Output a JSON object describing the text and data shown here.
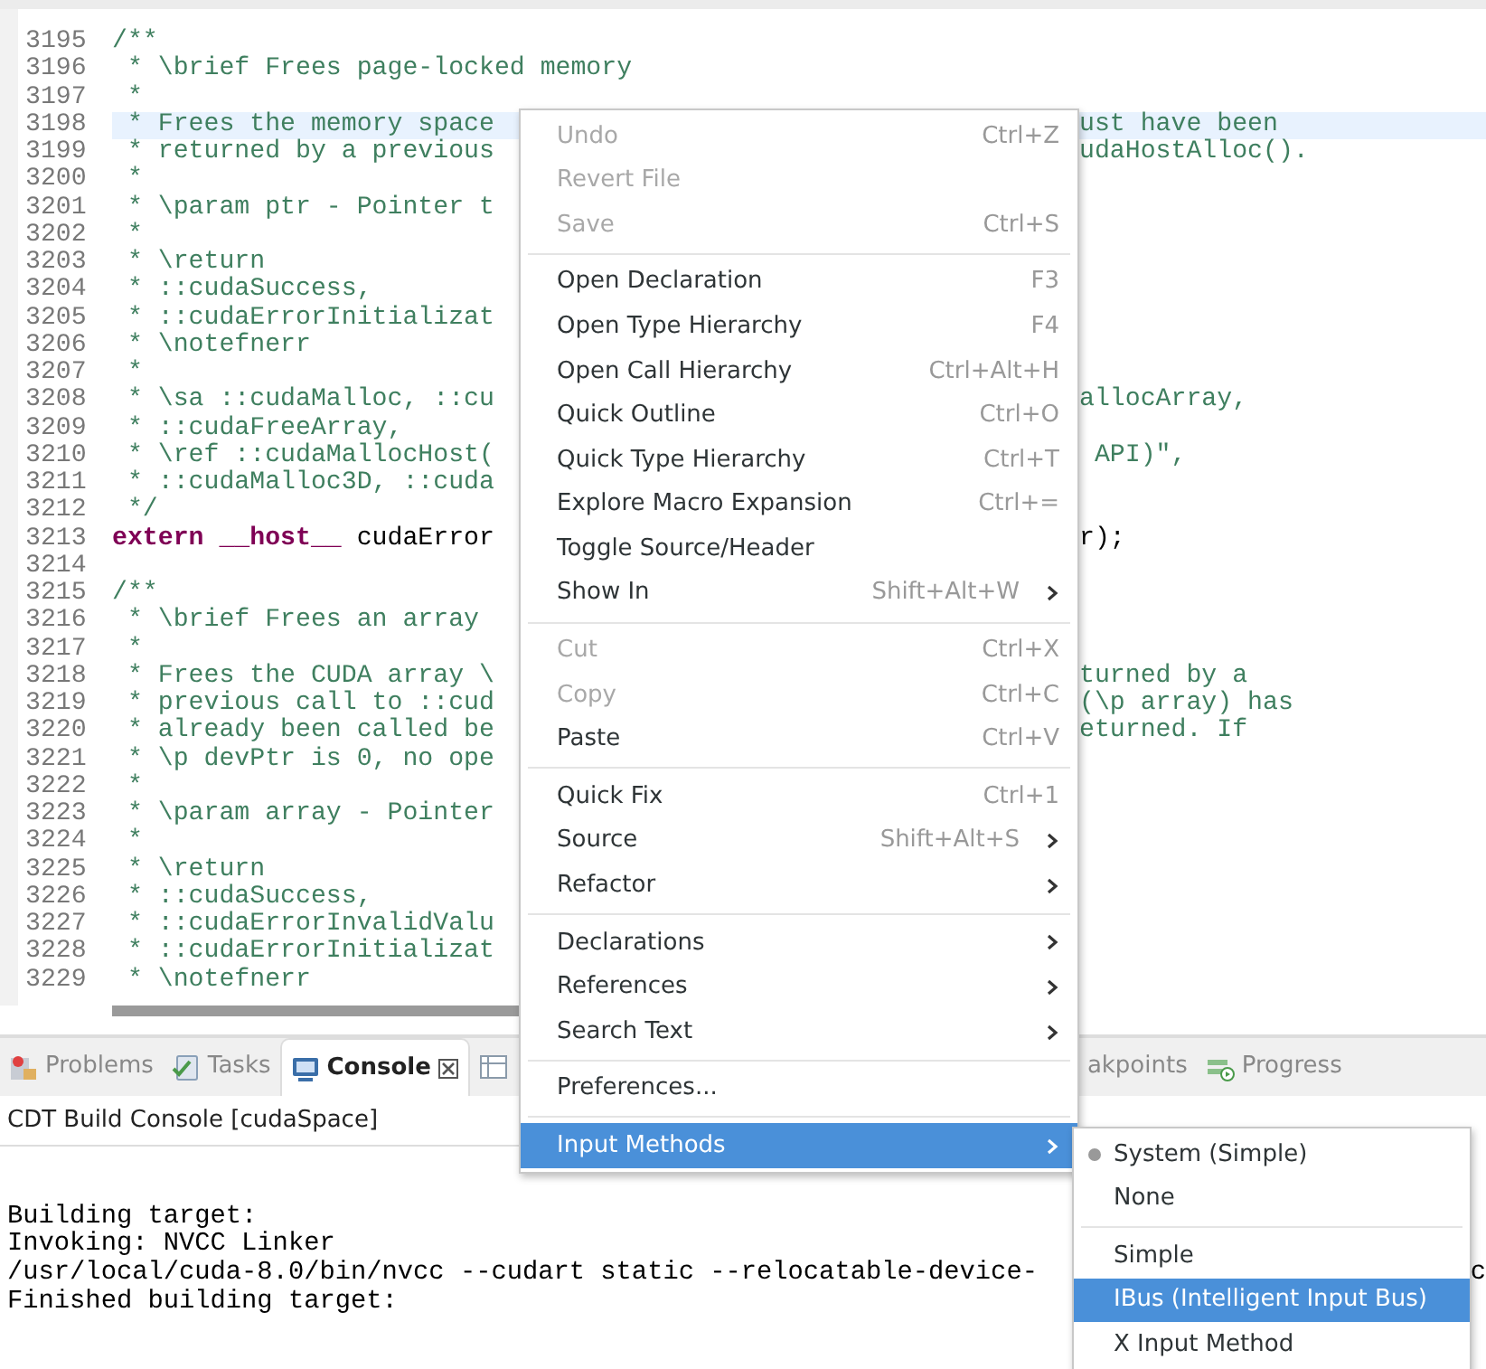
{
  "editor": {
    "lines": [
      {
        "number": "3195",
        "highlighted": false,
        "segments": [
          {
            "kind": "comment",
            "text": "/**"
          }
        ]
      },
      {
        "number": "3196",
        "highlighted": false,
        "segments": [
          {
            "kind": "comment",
            "text": " * \\brief Frees page-locked memory"
          }
        ]
      },
      {
        "number": "3197",
        "highlighted": false,
        "segments": [
          {
            "kind": "comment",
            "text": " *"
          }
        ]
      },
      {
        "number": "3198",
        "highlighted": true,
        "segments": [
          {
            "kind": "comment",
            "text": " * Frees the memory space"
          }
        ],
        "tail": "ust have been"
      },
      {
        "number": "3199",
        "highlighted": false,
        "segments": [
          {
            "kind": "comment",
            "text": " * returned by a previous"
          }
        ],
        "tail": "udaHostAlloc()."
      },
      {
        "number": "3200",
        "highlighted": false,
        "segments": [
          {
            "kind": "comment",
            "text": " *"
          }
        ]
      },
      {
        "number": "3201",
        "highlighted": false,
        "segments": [
          {
            "kind": "comment",
            "text": " * \\param ptr - Pointer t"
          }
        ]
      },
      {
        "number": "3202",
        "highlighted": false,
        "segments": [
          {
            "kind": "comment",
            "text": " *"
          }
        ]
      },
      {
        "number": "3203",
        "highlighted": false,
        "segments": [
          {
            "kind": "comment",
            "text": " * \\return"
          }
        ]
      },
      {
        "number": "3204",
        "highlighted": false,
        "segments": [
          {
            "kind": "comment",
            "text": " * ::cudaSuccess,"
          }
        ]
      },
      {
        "number": "3205",
        "highlighted": false,
        "segments": [
          {
            "kind": "comment",
            "text": " * ::cudaErrorInitializat"
          }
        ]
      },
      {
        "number": "3206",
        "highlighted": false,
        "segments": [
          {
            "kind": "comment",
            "text": " * \\notefnerr"
          }
        ]
      },
      {
        "number": "3207",
        "highlighted": false,
        "segments": [
          {
            "kind": "comment",
            "text": " *"
          }
        ]
      },
      {
        "number": "3208",
        "highlighted": false,
        "segments": [
          {
            "kind": "comment",
            "text": " * \\sa ::cudaMalloc, ::cu"
          }
        ],
        "tail": "allocArray,"
      },
      {
        "number": "3209",
        "highlighted": false,
        "segments": [
          {
            "kind": "comment",
            "text": " * ::cudaFreeArray,"
          }
        ]
      },
      {
        "number": "3210",
        "highlighted": false,
        "segments": [
          {
            "kind": "comment",
            "text": " * \\ref ::cudaMallocHost("
          }
        ],
        "tail": " API)\","
      },
      {
        "number": "3211",
        "highlighted": false,
        "segments": [
          {
            "kind": "comment",
            "text": " * ::cudaMalloc3D, ::cuda"
          }
        ]
      },
      {
        "number": "3212",
        "highlighted": false,
        "segments": [
          {
            "kind": "comment",
            "text": " */"
          }
        ]
      },
      {
        "number": "3213",
        "highlighted": false,
        "segments": [
          {
            "kind": "keyword",
            "text": "extern __host__"
          },
          {
            "kind": "plain",
            "text": " cudaError"
          }
        ],
        "tail": "r);"
      },
      {
        "number": "3214",
        "highlighted": false
      },
      {
        "number": "3215",
        "highlighted": false,
        "segments": [
          {
            "kind": "comment",
            "text": "/**"
          }
        ]
      },
      {
        "number": "3216",
        "highlighted": false,
        "segments": [
          {
            "kind": "comment",
            "text": " * \\brief Frees an array"
          }
        ]
      },
      {
        "number": "3217",
        "highlighted": false,
        "segments": [
          {
            "kind": "comment",
            "text": " *"
          }
        ]
      },
      {
        "number": "3218",
        "highlighted": false,
        "segments": [
          {
            "kind": "comment",
            "text": " * Frees the CUDA array \\"
          }
        ],
        "tail": "turned by a"
      },
      {
        "number": "3219",
        "highlighted": false,
        "segments": [
          {
            "kind": "comment",
            "text": " * previous call to ::cud"
          }
        ],
        "tail": "(\\p array) has"
      },
      {
        "number": "3220",
        "highlighted": false,
        "segments": [
          {
            "kind": "comment",
            "text": " * already been called be"
          }
        ],
        "tail": "eturned. If"
      },
      {
        "number": "3221",
        "highlighted": false,
        "segments": [
          {
            "kind": "comment",
            "text": " * \\p devPtr is 0, no ope"
          }
        ]
      },
      {
        "number": "3222",
        "highlighted": false,
        "segments": [
          {
            "kind": "comment",
            "text": " *"
          }
        ]
      },
      {
        "number": "3223",
        "highlighted": false,
        "segments": [
          {
            "kind": "comment",
            "text": " * \\param array - Pointer"
          }
        ]
      },
      {
        "number": "3224",
        "highlighted": false,
        "segments": [
          {
            "kind": "comment",
            "text": " *"
          }
        ]
      },
      {
        "number": "3225",
        "highlighted": false,
        "segments": [
          {
            "kind": "comment",
            "text": " * \\return"
          }
        ]
      },
      {
        "number": "3226",
        "highlighted": false,
        "segments": [
          {
            "kind": "comment",
            "text": " * ::cudaSuccess,"
          }
        ]
      },
      {
        "number": "3227",
        "highlighted": false,
        "segments": [
          {
            "kind": "comment",
            "text": " * ::cudaErrorInvalidValu"
          }
        ]
      },
      {
        "number": "3228",
        "highlighted": false,
        "segments": [
          {
            "kind": "comment",
            "text": " * ::cudaErrorInitializat"
          }
        ]
      },
      {
        "number": "3229",
        "highlighted": false,
        "segments": [
          {
            "kind": "comment",
            "text": " * \\notefnerr"
          }
        ]
      }
    ]
  },
  "panel": {
    "tabs": [
      {
        "kind": "problems",
        "label": "Problems",
        "selected": false
      },
      {
        "kind": "tasks",
        "label": "Tasks",
        "selected": false
      },
      {
        "kind": "console",
        "label": "Console",
        "selected": true
      },
      {
        "kind": "table"
      },
      {
        "kind": "breakpoints",
        "label": "akpoints",
        "selected": false
      },
      {
        "kind": "progress",
        "label": "Progress",
        "selected": false
      }
    ],
    "title": "CDT Build Console [cudaSpace]",
    "console_lines": [
      {
        "text": "Building target:"
      },
      {
        "text": "Invoking: NVCC Linker"
      },
      {
        "text": "/usr/local/cuda-8.0/bin/nvcc --cudart static --relocatable-device-",
        "tail": "c"
      },
      {
        "text": "Finished building target:"
      }
    ]
  },
  "context_menu": {
    "items": [
      {
        "kind": "item",
        "label": "Undo",
        "shortcut": "Ctrl+Z",
        "disabled": true,
        "submenu": false,
        "selected": false
      },
      {
        "kind": "item",
        "label": "Revert File",
        "disabled": true,
        "submenu": false,
        "selected": false
      },
      {
        "kind": "item",
        "label": "Save",
        "shortcut": "Ctrl+S",
        "disabled": true,
        "submenu": false,
        "selected": false
      },
      {
        "kind": "separator"
      },
      {
        "kind": "item",
        "label": "Open Declaration",
        "shortcut": "F3",
        "disabled": false,
        "submenu": false,
        "selected": false
      },
      {
        "kind": "item",
        "label": "Open Type Hierarchy",
        "shortcut": "F4",
        "disabled": false,
        "submenu": false,
        "selected": false
      },
      {
        "kind": "item",
        "label": "Open Call Hierarchy",
        "shortcut": "Ctrl+Alt+H",
        "disabled": false,
        "submenu": false,
        "selected": false
      },
      {
        "kind": "item",
        "label": "Quick Outline",
        "shortcut": "Ctrl+O",
        "disabled": false,
        "submenu": false,
        "selected": false
      },
      {
        "kind": "item",
        "label": "Quick Type Hierarchy",
        "shortcut": "Ctrl+T",
        "disabled": false,
        "submenu": false,
        "selected": false
      },
      {
        "kind": "item",
        "label": "Explore Macro Expansion",
        "shortcut": "Ctrl+=",
        "disabled": false,
        "submenu": false,
        "selected": false
      },
      {
        "kind": "item",
        "label": "Toggle Source/Header",
        "disabled": false,
        "submenu": false,
        "selected": false
      },
      {
        "kind": "item",
        "label": "Show In",
        "shortcut": "Shift+Alt+W",
        "disabled": false,
        "submenu": true,
        "selected": false
      },
      {
        "kind": "separator"
      },
      {
        "kind": "item",
        "label": "Cut",
        "shortcut": "Ctrl+X",
        "disabled": true,
        "submenu": false,
        "selected": false
      },
      {
        "kind": "item",
        "label": "Copy",
        "shortcut": "Ctrl+C",
        "disabled": true,
        "submenu": false,
        "selected": false
      },
      {
        "kind": "item",
        "label": "Paste",
        "shortcut": "Ctrl+V",
        "disabled": false,
        "submenu": false,
        "selected": false
      },
      {
        "kind": "separator"
      },
      {
        "kind": "item",
        "label": "Quick Fix",
        "shortcut": "Ctrl+1",
        "disabled": false,
        "submenu": false,
        "selected": false
      },
      {
        "kind": "item",
        "label": "Source",
        "shortcut": "Shift+Alt+S",
        "disabled": false,
        "submenu": true,
        "selected": false
      },
      {
        "kind": "item",
        "label": "Refactor",
        "disabled": false,
        "submenu": true,
        "selected": false
      },
      {
        "kind": "separator"
      },
      {
        "kind": "item",
        "label": "Declarations",
        "disabled": false,
        "submenu": true,
        "selected": false
      },
      {
        "kind": "item",
        "label": "References",
        "disabled": false,
        "submenu": true,
        "selected": false
      },
      {
        "kind": "item",
        "label": "Search Text",
        "disabled": false,
        "submenu": true,
        "selected": false
      },
      {
        "kind": "separator"
      },
      {
        "kind": "item",
        "label": "Preferences...",
        "disabled": false,
        "submenu": false,
        "selected": false
      },
      {
        "kind": "separator"
      },
      {
        "kind": "item",
        "label": "Input Methods",
        "disabled": false,
        "submenu": true,
        "selected": true
      }
    ]
  },
  "submenu": {
    "items": [
      {
        "kind": "radio",
        "label": "System (Simple)",
        "checked": true,
        "selected": false
      },
      {
        "kind": "item",
        "label": "None",
        "selected": false
      },
      {
        "kind": "separator"
      },
      {
        "kind": "item",
        "label": "Simple",
        "selected": false
      },
      {
        "kind": "item",
        "label": "IBus (Intelligent Input Bus)",
        "selected": true
      },
      {
        "kind": "item",
        "label": "X Input Method",
        "selected": false
      }
    ]
  }
}
